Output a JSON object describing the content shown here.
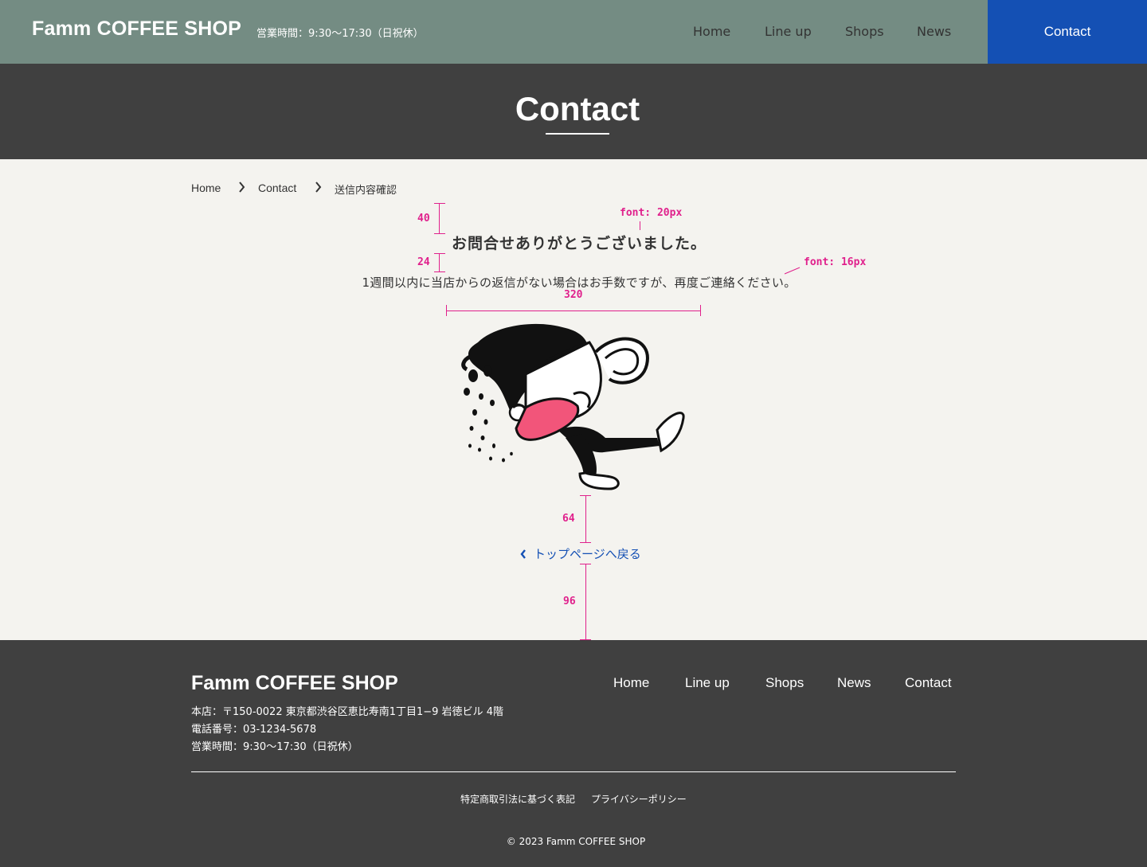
{
  "header": {
    "logo": "Famm COFFEE SHOP",
    "hours": "営業時間：9:30〜17:30（日祝休）",
    "nav": [
      "Home",
      "Line up",
      "Shops",
      "News"
    ],
    "contact": "Contact"
  },
  "hero": {
    "title": "Contact"
  },
  "breadcrumb": {
    "home": "Home",
    "contact": "Contact",
    "current": "送信内容確認"
  },
  "message": {
    "title": "お問合せありがとうございました。",
    "body": "1週間以内に当店からの返信がない場合はお手数ですが、再度ご連絡ください。"
  },
  "annotations": {
    "gap_top": "40",
    "gap_mid": "24",
    "font_title": "font: 20px",
    "font_body": "font: 16px",
    "image_width": "320",
    "gap_link": "64",
    "gap_bottom": "96"
  },
  "back_link": {
    "label": "トップページへ戻る",
    "icon": "chevron-left-icon"
  },
  "footer": {
    "logo": "Famm COFFEE SHOP",
    "address": "本店：〒150-0022 東京都渋谷区恵比寿南1丁目1−9 岩徳ビル 4階",
    "phone": "電話番号：03-1234-5678",
    "hours": "営業時間：9:30〜17:30（日祝休）",
    "nav": [
      "Home",
      "Line up",
      "Shops",
      "News",
      "Contact"
    ],
    "legal": [
      "特定商取引法に基づく表記",
      "プライバシーポリシー"
    ],
    "copyright": "© 2023 Famm COFFEE SHOP"
  },
  "colors": {
    "header_bg": "#748c83",
    "accent": "#1450b4",
    "dark_bg": "#404040",
    "page_bg": "#f4f3ef",
    "annotation": "#e0208c"
  }
}
